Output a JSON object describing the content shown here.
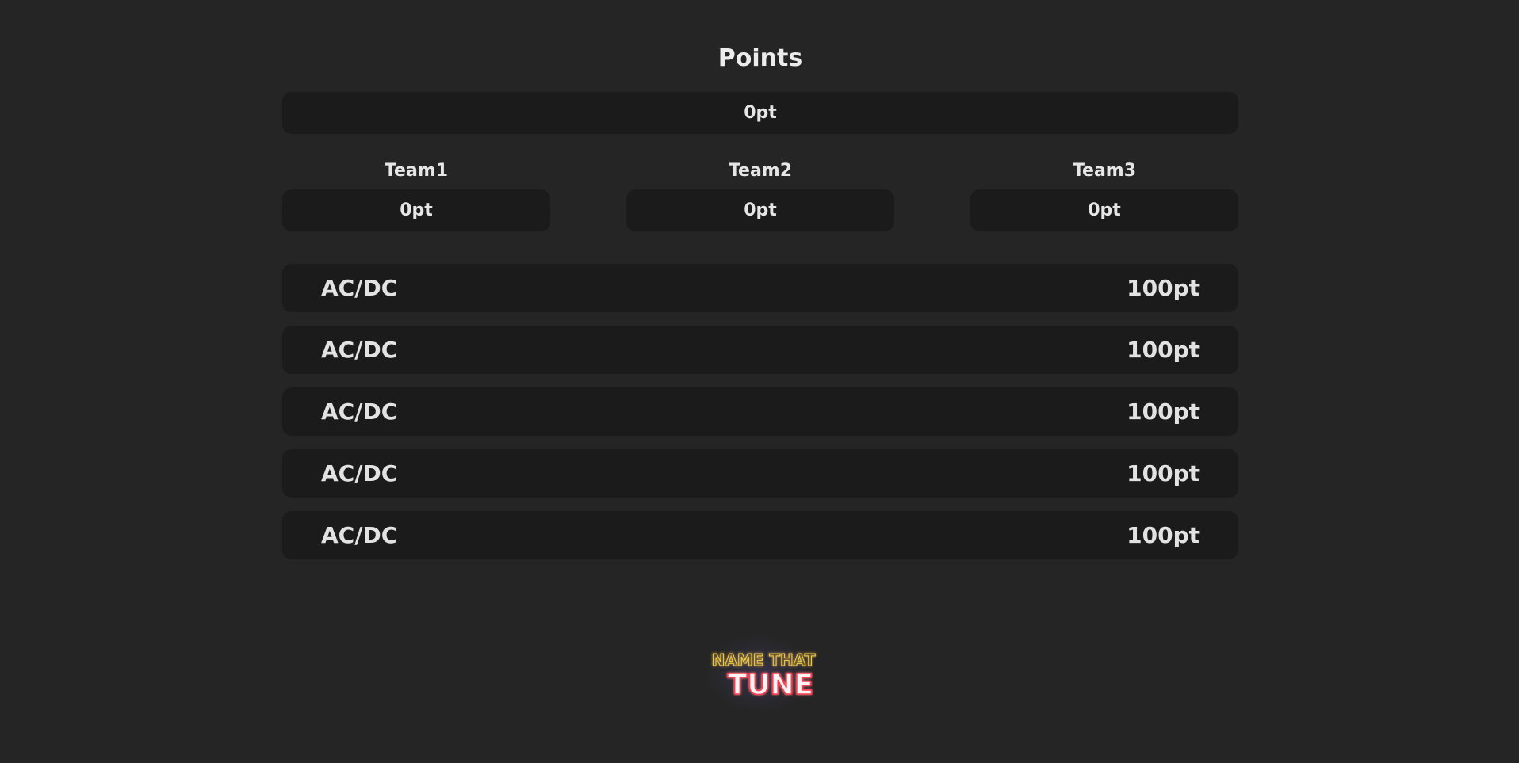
{
  "header": {
    "title": "Points"
  },
  "total": {
    "score": "0pt"
  },
  "teams": [
    {
      "name": "Team1",
      "score": "0pt"
    },
    {
      "name": "Team2",
      "score": "0pt"
    },
    {
      "name": "Team3",
      "score": "0pt"
    }
  ],
  "songs": [
    {
      "artist": "AC/DC",
      "points": "100pt"
    },
    {
      "artist": "AC/DC",
      "points": "100pt"
    },
    {
      "artist": "AC/DC",
      "points": "100pt"
    },
    {
      "artist": "AC/DC",
      "points": "100pt"
    },
    {
      "artist": "AC/DC",
      "points": "100pt"
    }
  ],
  "logo": {
    "line1": "NAME THAT",
    "line2": "TUNE"
  },
  "colors": {
    "background": "#252525",
    "panel": "#1b1b1b",
    "text": "#e6e6e6",
    "logo_yellow": "#f0c64a",
    "logo_red": "#ff3b4f"
  }
}
